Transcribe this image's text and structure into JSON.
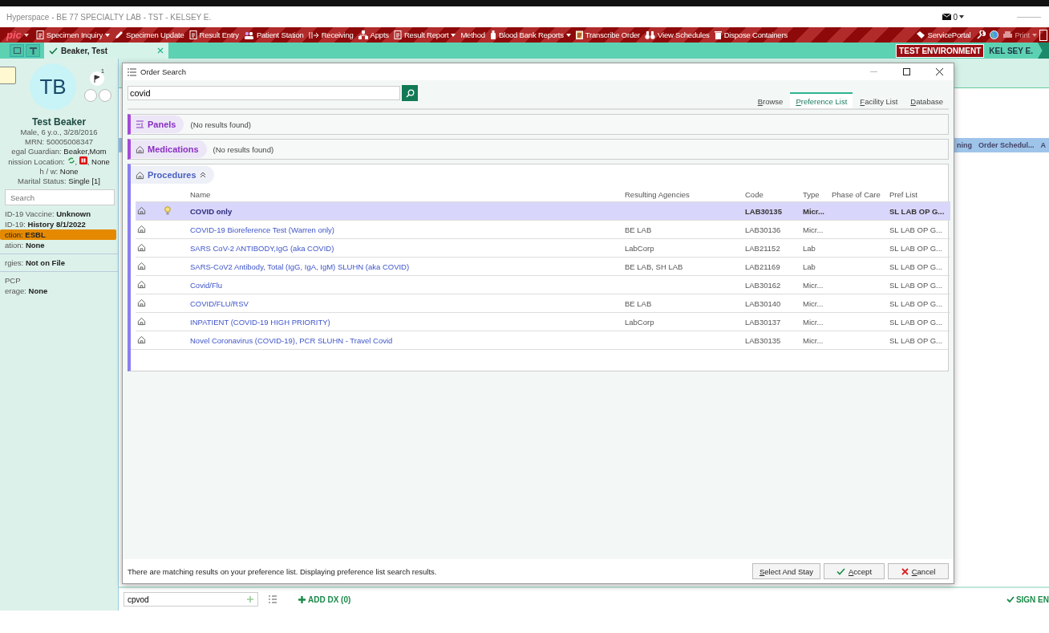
{
  "window": {
    "title": "Hyperspace - BE 77 SPECIALTY LAB - TST - KELSEY E.",
    "mail_count": "0"
  },
  "toolbar": {
    "logo": "pic",
    "items": [
      {
        "label": "Specimen Inquiry",
        "dropdown": true
      },
      {
        "label": "Specimen Update",
        "dropdown": false
      },
      {
        "label": "Result Entry",
        "dropdown": false
      },
      {
        "label": "Patient Station",
        "dropdown": false
      },
      {
        "label": "Receiving",
        "dropdown": false
      },
      {
        "label": "Appts",
        "dropdown": false
      },
      {
        "label": "Result Report",
        "dropdown": true
      },
      {
        "label": "Method",
        "dropdown": false
      },
      {
        "label": "Blood Bank Reports",
        "dropdown": true
      },
      {
        "label": "Transcribe Order",
        "dropdown": false
      },
      {
        "label": "View Schedules",
        "dropdown": false
      },
      {
        "label": "Dispose Containers",
        "dropdown": false
      }
    ],
    "right_items": [
      {
        "label": "ServicePortal",
        "disabled": false,
        "dropdown": false
      },
      {
        "label": "Print",
        "disabled": true,
        "dropdown": true
      }
    ]
  },
  "tabbar": {
    "tab": "Beaker, Test",
    "environment": "TEST ENVIRONMENT",
    "user": "KEL SEY E."
  },
  "patient": {
    "initials": "TB",
    "flag_count": "1",
    "name": "Test Beaker",
    "lines": [
      {
        "label": "Male, 6 y.o., 3/28/2016"
      },
      {
        "label": "MRN: 50005008347"
      },
      {
        "label": "egal Guardian:",
        "value": "Beaker,Mom"
      },
      {
        "label": "nission Location:",
        "separator": ",",
        "value": ", None",
        "kind": "location"
      },
      {
        "label": "h / w:",
        "value": "None"
      },
      {
        "label": "Marital Status:",
        "value": "Single [1]"
      }
    ],
    "search": {
      "placeholder": "Search"
    },
    "facts": [
      {
        "label": "ID-19 Vaccine:",
        "value": "Unknown",
        "kind": "plain"
      },
      {
        "label": "ID-19:",
        "value": "History 8/1/2022",
        "kind": "plain"
      },
      {
        "label": "ction:",
        "value": "ESBL",
        "kind": "alert"
      },
      {
        "label": "ation:",
        "value": "None",
        "kind": "plain"
      },
      {
        "label": "rgies:",
        "value": "Not on File",
        "kind": "divided"
      },
      {
        "label": "PCP",
        "kind": "divided"
      },
      {
        "label": "erage:",
        "value": "None",
        "kind": "plain"
      }
    ]
  },
  "background_strip": [
    "ning",
    "Order Schedul...",
    "A"
  ],
  "dialog": {
    "title": "Order Search",
    "search_value": "covid",
    "tabs": [
      {
        "label": "Browse",
        "selected": false
      },
      {
        "label": "Preference List",
        "selected": true
      },
      {
        "label": "Facility List",
        "selected": false
      },
      {
        "label": "Database",
        "selected": false
      }
    ],
    "sections": [
      {
        "title": "Panels",
        "note": "(No results found)",
        "expanded": false
      },
      {
        "title": "Medications",
        "note": "(No results found)",
        "expanded": false
      },
      {
        "title": "Procedures",
        "expanded": true
      }
    ],
    "table": {
      "columns": [
        "Name",
        "Resulting Agencies",
        "Code",
        "Type",
        "Phase of Care",
        "Pref List"
      ],
      "rows": [
        {
          "name": "COVID only",
          "code": "LAB30135",
          "type": "Micr...",
          "pref": "SL LAB OP G...",
          "selected": true,
          "suggested": true
        },
        {
          "name": "COVID-19 Bioreference Test (Warren only)",
          "agencies": "BE LAB",
          "code": "LAB30136",
          "type": "Micr...",
          "pref": "SL LAB OP G...",
          "selected": false,
          "suggested": false
        },
        {
          "name": "SARS CoV-2 ANTIBODY,IgG (aka COVID)",
          "agencies": "LabCorp",
          "code": "LAB21152",
          "type": "Lab",
          "pref": "SL LAB OP G...",
          "selected": false,
          "suggested": false
        },
        {
          "name": "SARS-CoV2 Antibody, Total (IgG, IgA, IgM) SLUHN (aka COVID)",
          "agencies": "BE LAB, SH LAB",
          "code": "LAB21169",
          "type": "Lab",
          "pref": "SL LAB OP G...",
          "selected": false,
          "suggested": false
        },
        {
          "name": "Covid/Flu",
          "code": "LAB30162",
          "type": "Micr...",
          "pref": "SL LAB OP G...",
          "selected": false,
          "suggested": false
        },
        {
          "name": "COVID/FLU/RSV",
          "agencies": "BE LAB",
          "code": "LAB30140",
          "type": "Micr...",
          "pref": "SL LAB OP G...",
          "selected": false,
          "suggested": false
        },
        {
          "name": "INPATIENT (COVID-19 HIGH PRIORITY)",
          "agencies": "LabCorp",
          "code": "LAB30137",
          "type": "Micr...",
          "pref": "SL LAB OP G...",
          "selected": false,
          "suggested": false
        },
        {
          "name": "Novel Coronavirus (COVID-19), PCR SLUHN - Travel Covid",
          "code": "LAB30135",
          "type": "Micr...",
          "pref": "SL LAB OP G...",
          "selected": false,
          "suggested": false
        }
      ]
    },
    "message": "There are matching results on your preference list. Displaying preference list search results.",
    "buttons": [
      {
        "label": "Select And Stay",
        "kind": "plain"
      },
      {
        "label": "Accept",
        "kind": "accept"
      },
      {
        "label": "Cancel",
        "kind": "cancel"
      }
    ]
  },
  "bottom": {
    "dx_value": "cpvod",
    "add_dx": "ADD DX (0)",
    "sign": "SIGN EN"
  }
}
